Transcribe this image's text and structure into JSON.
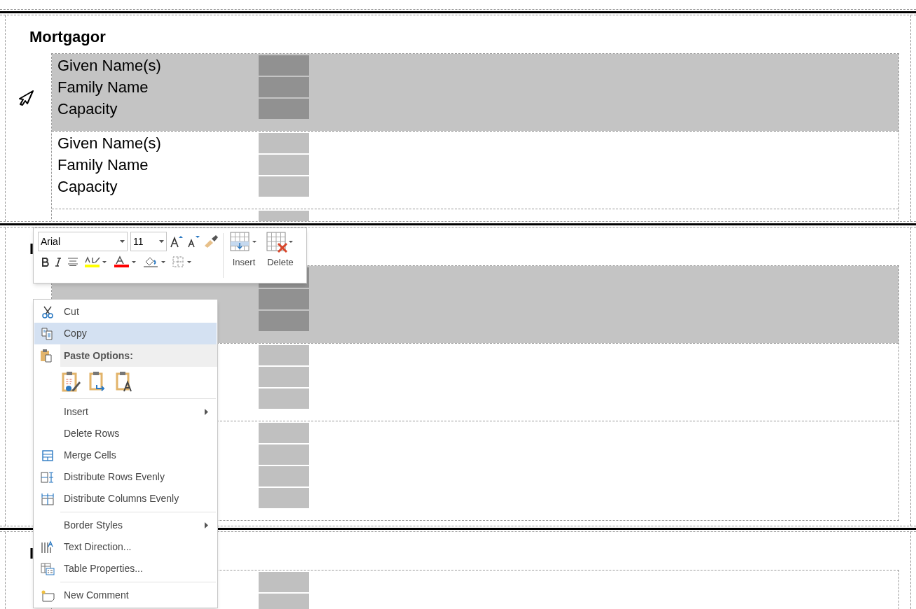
{
  "sections": [
    {
      "heading": "Mortgagor",
      "rows": [
        {
          "selected": true,
          "lines": [
            {
              "kind": "field",
              "label": "Given Name(s)"
            },
            {
              "kind": "field",
              "label": "Family Name"
            },
            {
              "kind": "field",
              "label": "Capacity"
            }
          ]
        },
        {
          "selected": false,
          "lines": [
            {
              "kind": "field",
              "label": "Given Name(s)"
            },
            {
              "kind": "field",
              "label": "Family Name"
            },
            {
              "kind": "field",
              "label": "Capacity"
            }
          ]
        },
        {
          "selected": false,
          "lines": [
            {
              "kind": "field"
            }
          ]
        }
      ]
    },
    {
      "heading": "I",
      "rows": [
        {
          "selected": true,
          "lines": [
            {
              "kind": "field"
            },
            {
              "kind": "field"
            },
            {
              "kind": "field"
            }
          ]
        },
        {
          "selected": false,
          "lines": [
            {
              "kind": "field"
            },
            {
              "kind": "field"
            },
            {
              "kind": "field"
            }
          ]
        },
        {
          "selected": false,
          "lines": [
            {
              "kind": "field"
            },
            {
              "kind": "field"
            },
            {
              "kind": "field"
            },
            {
              "kind": "field"
            }
          ]
        }
      ]
    },
    {
      "heading": "I",
      "rows": [
        {
          "selected": false,
          "lines": [
            {
              "kind": "field"
            },
            {
              "kind": "field"
            }
          ]
        }
      ]
    }
  ],
  "mini_toolbar": {
    "font": "Arial",
    "size": "11",
    "insert": "Insert",
    "delete": "Delete"
  },
  "context_menu": {
    "items": [
      {
        "kind": "item",
        "label": "Cut",
        "selected": false,
        "submenu": false
      },
      {
        "kind": "item",
        "label": "Copy",
        "selected": true,
        "submenu": false
      },
      {
        "kind": "header",
        "label": "Paste Options:"
      },
      {
        "kind": "paste_icons"
      },
      {
        "kind": "separator"
      },
      {
        "kind": "item",
        "label": "Insert",
        "selected": false,
        "submenu": true
      },
      {
        "kind": "item",
        "label": "Delete Rows",
        "selected": false,
        "submenu": false
      },
      {
        "kind": "item",
        "label": "Merge Cells",
        "selected": false,
        "submenu": false
      },
      {
        "kind": "item",
        "label": "Distribute Rows Evenly",
        "selected": false,
        "submenu": false
      },
      {
        "kind": "item",
        "label": "Distribute Columns Evenly",
        "selected": false,
        "submenu": false
      },
      {
        "kind": "separator"
      },
      {
        "kind": "item",
        "label": "Border Styles",
        "selected": false,
        "submenu": true
      },
      {
        "kind": "item",
        "label": "Text Direction...",
        "selected": false,
        "submenu": false
      },
      {
        "kind": "item",
        "label": "Table Properties...",
        "selected": false,
        "submenu": false
      },
      {
        "kind": "separator"
      },
      {
        "kind": "item",
        "label": "New Comment",
        "selected": false,
        "submenu": false
      }
    ]
  }
}
